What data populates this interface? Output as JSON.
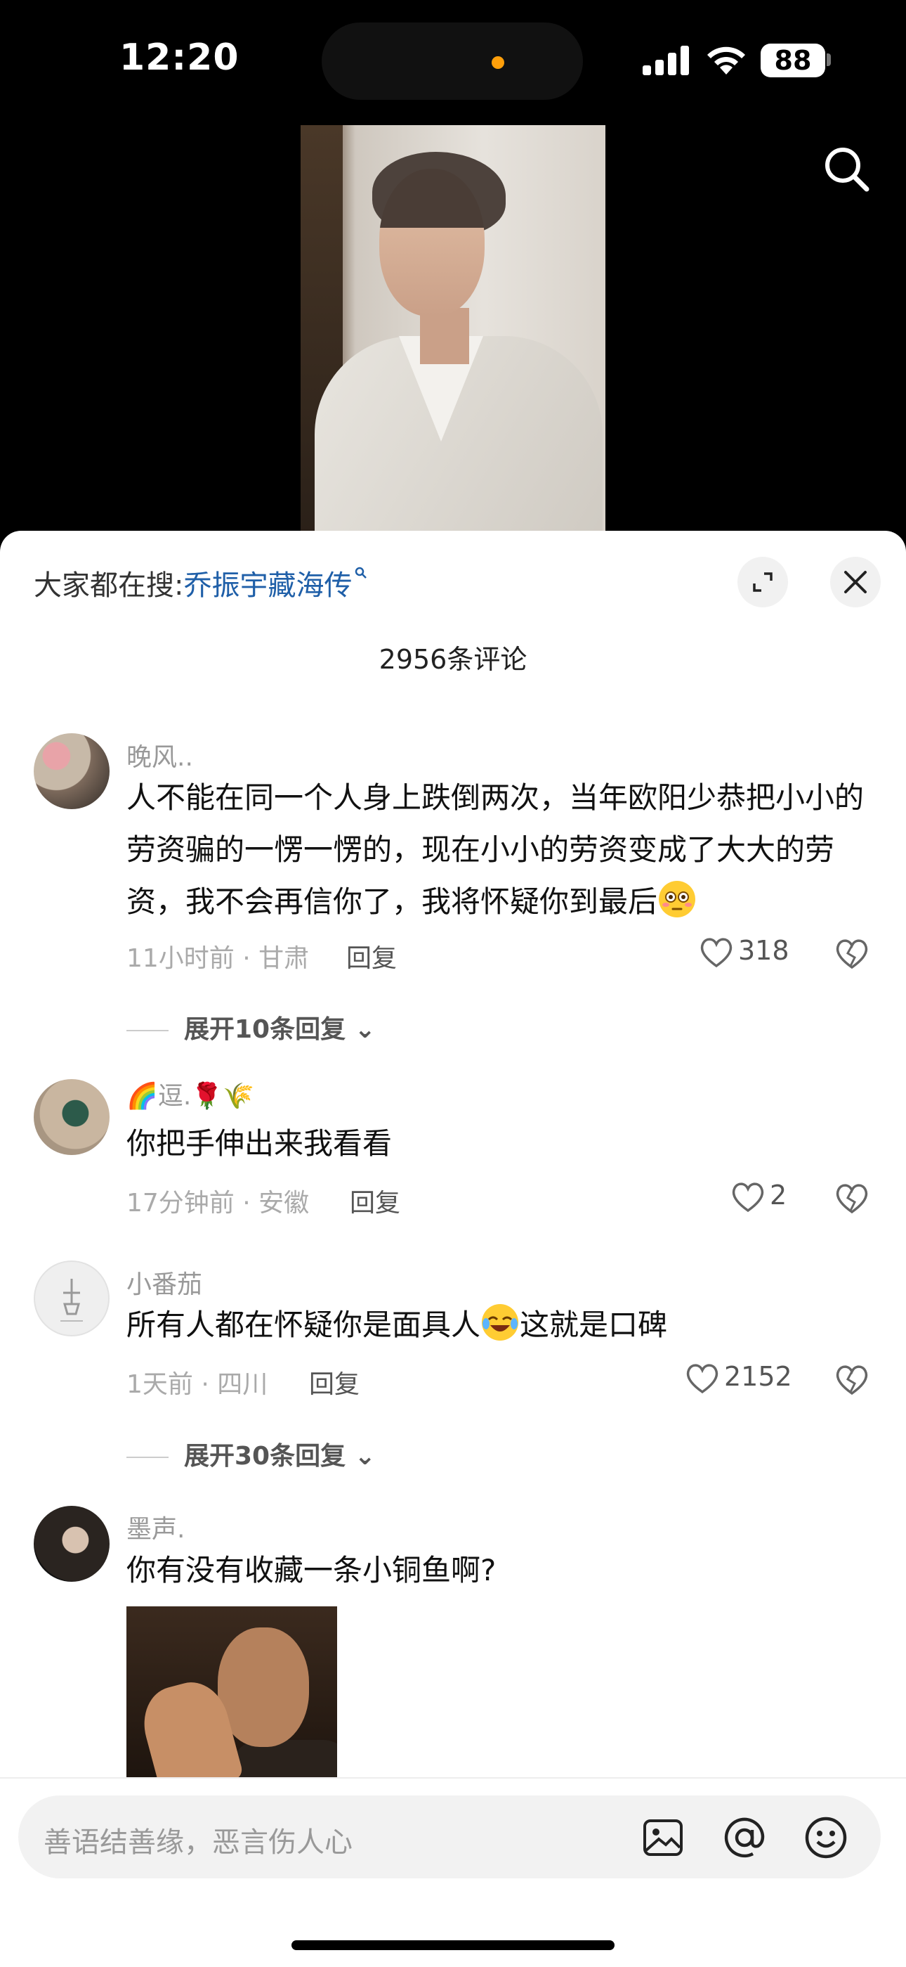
{
  "status_bar": {
    "time": "12:20",
    "battery": "88"
  },
  "hot_search": {
    "prefix": "大家都在搜:",
    "term": "乔振宇藏海传"
  },
  "comment_count": "2956条评论",
  "comments": [
    {
      "user": "晚风..",
      "text": "人不能在同一个人身上跌倒两次，当年欧阳少恭把小小的劳资骗的一愣一愣的，现在小小的劳资变成了大大的劳资，我不会再信你了，我将怀疑你到最后",
      "meta": "11小时前 · 甘肃",
      "reply": "回复",
      "likes": "318",
      "expand": "展开10条回复"
    },
    {
      "user_suffix": "逗.",
      "text": "你把手伸出来我看看",
      "meta": "17分钟前 · 安徽",
      "reply": "回复",
      "likes": "2"
    },
    {
      "user": "小番茄",
      "text_a": "所有人都在怀疑你是面具人",
      "text_b": "这就是口碑",
      "meta": "1天前 · 四川",
      "reply": "回复",
      "likes": "2152",
      "expand": "展开30条回复"
    },
    {
      "user": "墨声.",
      "text": "你有没有收藏一条小铜鱼啊?"
    }
  ],
  "input": {
    "placeholder": "善语结善缘，恶言伤人心"
  },
  "colors": {
    "link": "#1f5fa8",
    "accent_dot": "#ff9f0a"
  }
}
